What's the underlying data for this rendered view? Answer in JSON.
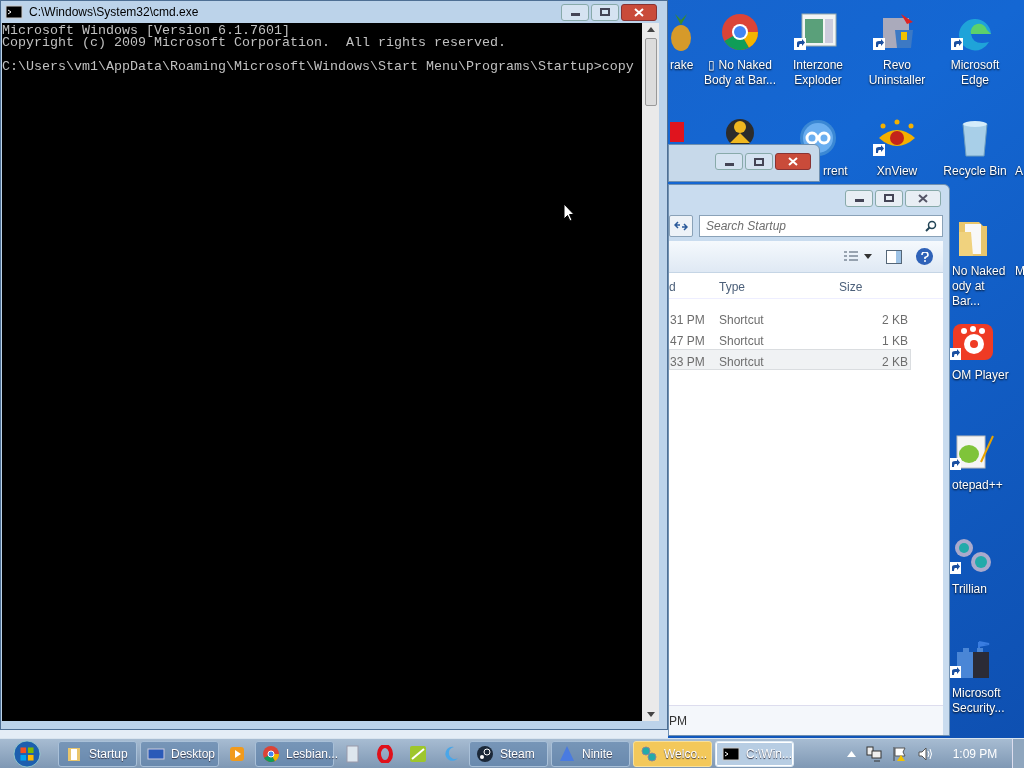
{
  "cmd": {
    "title": "C:\\Windows\\System32\\cmd.exe",
    "lines": [
      {
        "kind": "output",
        "text": "Microsoft Windows [Version 6.1.7601]"
      },
      {
        "kind": "output",
        "text": "Copyright (c) 2009 Microsoft Corporation.  All rights reserved."
      },
      {
        "kind": "prompt",
        "text": "C:\\Users\\vm1\\AppData\\Roaming\\Microsoft\\Windows\\Start Menu\\Programs\\Startup>copy"
      }
    ]
  },
  "desktop_icons": [
    {
      "label": "rake"
    },
    {
      "label": "▯ No Naked Body at Bar..."
    },
    {
      "label": "Interzone Exploder"
    },
    {
      "label": "Revo Uninstaller"
    },
    {
      "label": "Microsoft Edge"
    },
    {
      "label": "rrent"
    },
    {
      "label": "XnView"
    },
    {
      "label": "Recycle Bin"
    },
    {
      "label": "A"
    },
    {
      "label": "No Naked ody at Bar..."
    },
    {
      "label": "M"
    },
    {
      "label": "OM Player"
    },
    {
      "label": "otepad++"
    },
    {
      "label": "Trillian"
    },
    {
      "label": "Microsoft Security..."
    }
  ],
  "explorer": {
    "search": {
      "placeholder": "Search Startup"
    },
    "columns": [
      "d",
      "Type",
      "Size"
    ],
    "rows": [
      {
        "cells": [
          "31 PM",
          "Shortcut",
          "2 KB"
        ],
        "selected": false
      },
      {
        "cells": [
          "47 PM",
          "Shortcut",
          "1 KB"
        ],
        "selected": false
      },
      {
        "cells": [
          "33 PM",
          "Shortcut",
          "2 KB"
        ],
        "selected": true
      }
    ],
    "status": "PM"
  },
  "taskbar": {
    "items": [
      {
        "kind": "window",
        "label": "Startup",
        "selected": false,
        "flashing": false
      },
      {
        "kind": "window",
        "label": "Desktop",
        "selected": false,
        "flashing": false
      },
      {
        "kind": "pinned"
      },
      {
        "kind": "window",
        "label": "Lesbian...",
        "selected": false,
        "flashing": false
      },
      {
        "kind": "pinned"
      },
      {
        "kind": "pinned"
      },
      {
        "kind": "pinned"
      },
      {
        "kind": "pinned"
      },
      {
        "kind": "window",
        "label": "Steam",
        "selected": false,
        "flashing": false
      },
      {
        "kind": "window",
        "label": "Ninite",
        "selected": false,
        "flashing": false
      },
      {
        "kind": "window",
        "label": "Welco...",
        "selected": false,
        "flashing": true
      },
      {
        "kind": "window",
        "label": "C:\\Win...",
        "selected": true,
        "flashing": false
      }
    ],
    "time": "1:09 PM"
  }
}
